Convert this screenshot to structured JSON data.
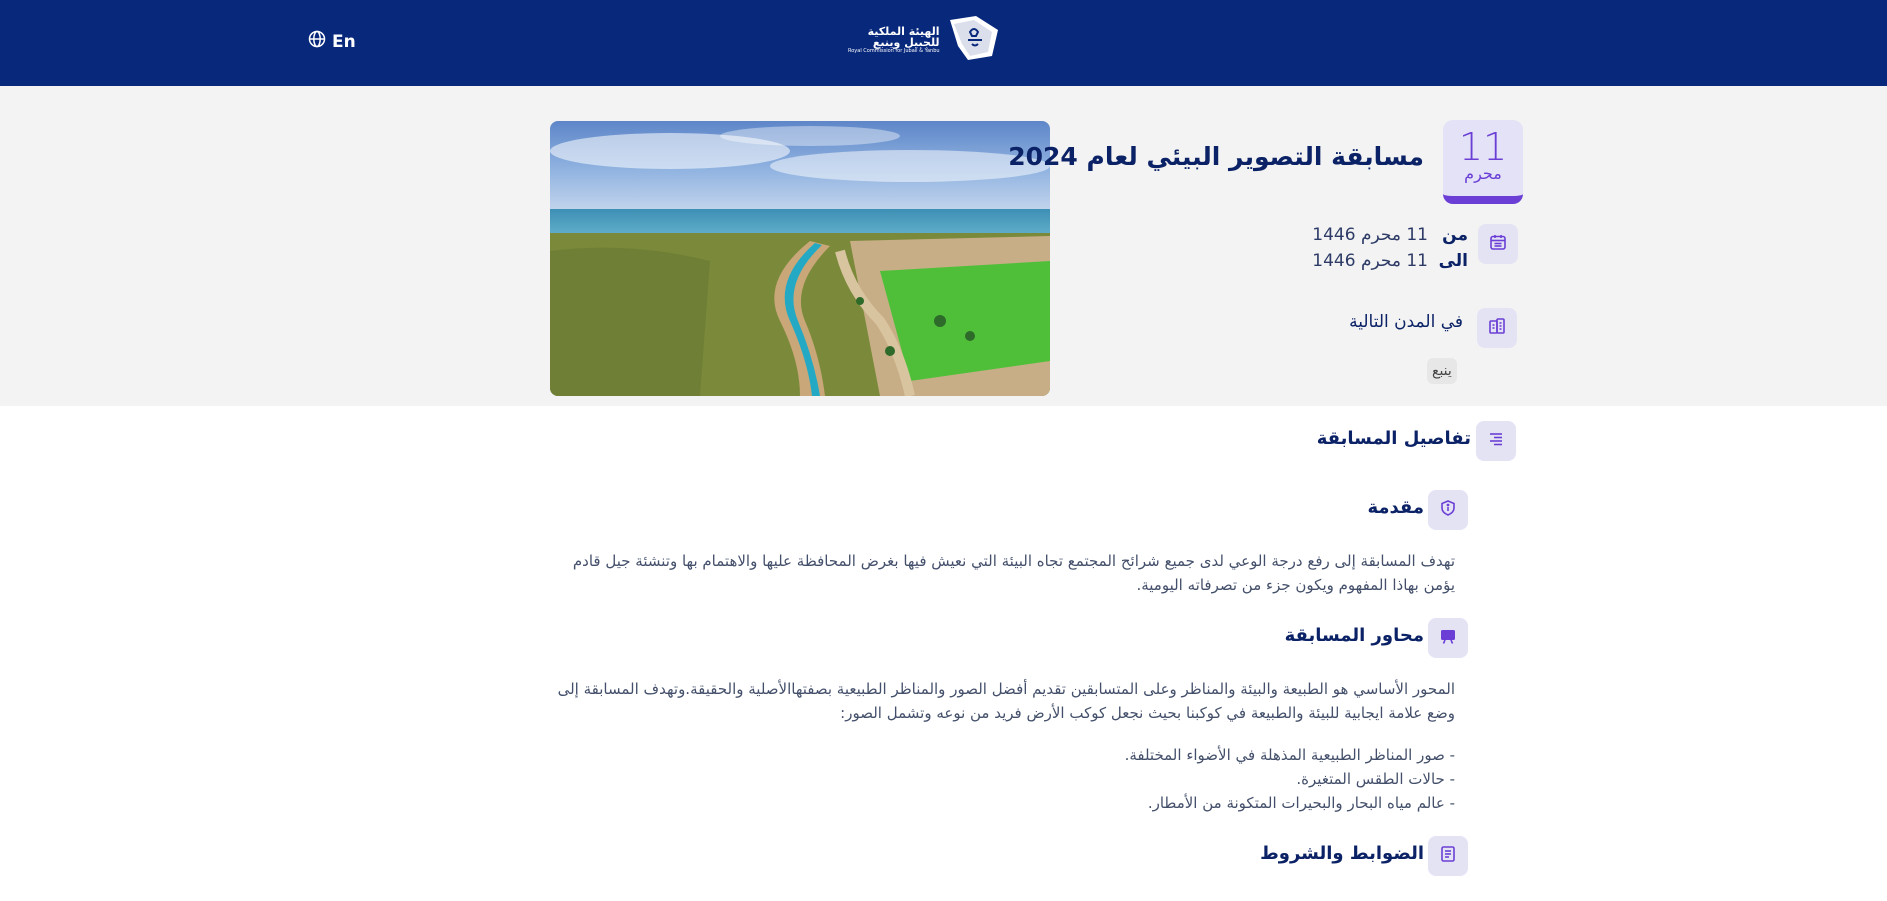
{
  "header": {
    "lang_label": "En",
    "logo_line1": "الهيئة الملكية",
    "logo_line2": "للجبيل وينبع",
    "logo_line3": "Royal Commission for Jubail & Yanbu"
  },
  "event": {
    "day": "11",
    "month": "محرم",
    "title": "مسابقة التصوير البيئي لعام 2024",
    "from_label": "من",
    "from_value": "11 محرم 1446",
    "to_label": "الى",
    "to_value": "11 محرم 1446",
    "cities_label": "في المدن التالية",
    "cities": [
      "ينبع"
    ]
  },
  "details": {
    "title": "تفاصيل المسابقة",
    "intro": {
      "title": "مقدمة",
      "text": "تهدف المسابقة إلى رفع درجة الوعي لدى جميع شرائح المجتمع تجاه البيئة التي نعيش فيها بغرض المحافظة عليها والاهتمام بها وتنشئة جيل قادم يؤمن بهاذا المفهوم ويكون جزء من تصرفاته اليومية."
    },
    "axes": {
      "title": "محاور المسابقة",
      "text": "المحور الأساسي هو الطبيعة والبيئة والمناظر وعلى المتسابقين تقديم أفضل الصور والمناظر الطبيعية بصفتهاالأصلية والحقيقة.وتهدف المسابقة إلى وضع علامة ايجابية للبيئة والطبيعة في كوكبنا بحيث نجعل كوكب الأرض فريد من نوعه وتشمل الصور:",
      "bullets": [
        "- صور المناظر الطبيعية المذهلة في الأضواء المختلفة.",
        "- حالات الطقس المتغيرة.",
        "- عالم مياه البحار والبحيرات المتكونة من الأمطار."
      ]
    },
    "rules": {
      "title": "الضوابط والشروط"
    }
  },
  "colors": {
    "header_bg": "#08287c",
    "accent": "#6b3fd6",
    "title": "#0b2266",
    "hero_bg": "#f3f3f3"
  }
}
